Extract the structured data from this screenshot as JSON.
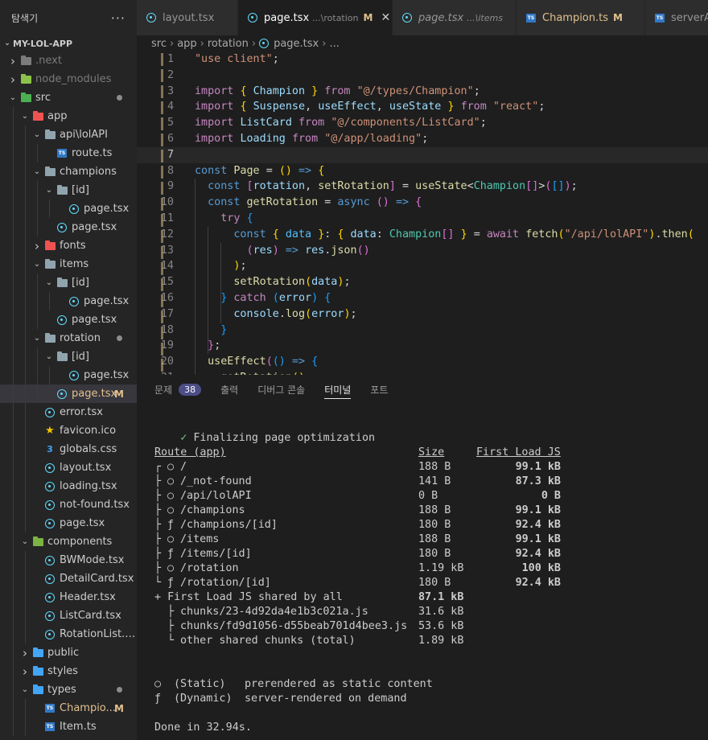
{
  "sidebar": {
    "title": "탐색기",
    "more": "···",
    "root": "MY-LOL-APP",
    "items": [
      {
        "label": ".next",
        "type": "folder-next"
      },
      {
        "label": "node_modules",
        "type": "folder-node"
      },
      {
        "label": "src",
        "type": "folder-src"
      },
      {
        "label": "app",
        "type": "folder-app"
      },
      {
        "label": "api\\lolAPI",
        "type": "folder"
      },
      {
        "label": "route.ts",
        "type": "ts"
      },
      {
        "label": "champions",
        "type": "folder"
      },
      {
        "label": "[id]",
        "type": "folder"
      },
      {
        "label": "page.tsx",
        "type": "react"
      },
      {
        "label": "page.tsx",
        "type": "react"
      },
      {
        "label": "fonts",
        "type": "folder-fonts"
      },
      {
        "label": "items",
        "type": "folder"
      },
      {
        "label": "[id]",
        "type": "folder"
      },
      {
        "label": "page.tsx",
        "type": "react"
      },
      {
        "label": "page.tsx",
        "type": "react"
      },
      {
        "label": "rotation",
        "type": "folder"
      },
      {
        "label": "[id]",
        "type": "folder"
      },
      {
        "label": "page.tsx",
        "type": "react"
      },
      {
        "label": "page.tsx",
        "type": "react",
        "badge": "M"
      },
      {
        "label": "error.tsx",
        "type": "react"
      },
      {
        "label": "favicon.ico",
        "type": "star"
      },
      {
        "label": "globals.css",
        "type": "css"
      },
      {
        "label": "layout.tsx",
        "type": "react"
      },
      {
        "label": "loading.tsx",
        "type": "react"
      },
      {
        "label": "not-found.tsx",
        "type": "react"
      },
      {
        "label": "page.tsx",
        "type": "react"
      },
      {
        "label": "components",
        "type": "folder-comp"
      },
      {
        "label": "BWMode.tsx",
        "type": "react"
      },
      {
        "label": "DetailCard.tsx",
        "type": "react"
      },
      {
        "label": "Header.tsx",
        "type": "react"
      },
      {
        "label": "ListCard.tsx",
        "type": "react"
      },
      {
        "label": "RotationList.tsx",
        "type": "react"
      },
      {
        "label": "public",
        "type": "folder-public"
      },
      {
        "label": "styles",
        "type": "folder-styles"
      },
      {
        "label": "types",
        "type": "folder-types"
      },
      {
        "label": "Champio...",
        "type": "ts",
        "badge": "M"
      },
      {
        "label": "Item.ts",
        "type": "ts"
      }
    ]
  },
  "tabs": [
    {
      "label": "layout.tsx",
      "path": "",
      "flag": ""
    },
    {
      "label": "page.tsx",
      "path": "...\\rotation",
      "flag": "M"
    },
    {
      "label": "page.tsx",
      "path": "...\\items",
      "flag": ""
    },
    {
      "label": "Champion.ts",
      "path": "",
      "flag": "M"
    },
    {
      "label": "serverA",
      "path": "",
      "flag": ""
    }
  ],
  "breadcrumb": [
    "src",
    "app",
    "rotation",
    "page.tsx",
    "..."
  ],
  "editor": {
    "line_numbers": [
      "1",
      "2",
      "3",
      "4",
      "5",
      "6",
      "7",
      "8",
      "9",
      "10",
      "11",
      "12",
      "13",
      "14",
      "15",
      "16",
      "17",
      "18",
      "19",
      "20",
      "21"
    ],
    "current_line": "7"
  },
  "panel": {
    "tabs": [
      "문제",
      "출력",
      "디버그 콘솔",
      "터미널",
      "포트"
    ],
    "problems_count": "38"
  },
  "terminal": {
    "check": "✓",
    "finalizing": "Finalizing page optimization",
    "headers": {
      "route": "Route (app)",
      "size": "Size",
      "first_load": "First Load JS"
    },
    "routes": [
      {
        "tree": "┌",
        "sym": "○",
        "path": "/",
        "size": "188 B",
        "load": "99.1 kB"
      },
      {
        "tree": "├",
        "sym": "○",
        "path": "/_not-found",
        "size": "141 B",
        "load": "87.3 kB"
      },
      {
        "tree": "├",
        "sym": "○",
        "path": "/api/lolAPI",
        "size": "0 B",
        "load": "0 B"
      },
      {
        "tree": "├",
        "sym": "○",
        "path": "/champions",
        "size": "188 B",
        "load": "99.1 kB"
      },
      {
        "tree": "├",
        "sym": "ƒ",
        "path": "/champions/[id]",
        "size": "180 B",
        "load": "92.4 kB"
      },
      {
        "tree": "├",
        "sym": "○",
        "path": "/items",
        "size": "188 B",
        "load": "99.1 kB"
      },
      {
        "tree": "├",
        "sym": "ƒ",
        "path": "/items/[id]",
        "size": "180 B",
        "load": "92.4 kB"
      },
      {
        "tree": "├",
        "sym": "○",
        "path": "/rotation",
        "size": "1.19 kB",
        "load": "100 kB"
      },
      {
        "tree": "└",
        "sym": "ƒ",
        "path": "/rotation/[id]",
        "size": "180 B",
        "load": "92.4 kB"
      }
    ],
    "shared": {
      "label": "+ First Load JS shared by all",
      "value": "87.1 kB"
    },
    "chunks": [
      {
        "tree": "├",
        "name": "chunks/23-4d92da4e1b3c021a.js",
        "size": "31.6 kB"
      },
      {
        "tree": "├",
        "name": "chunks/fd9d1056-d55beab701d4bee3.js",
        "size": "53.6 kB"
      },
      {
        "tree": "└",
        "name": "other shared chunks (total)",
        "size": "1.89 kB"
      }
    ],
    "legend": [
      {
        "sym": "○",
        "kind": "(Static)",
        "desc": "prerendered as static content"
      },
      {
        "sym": "ƒ",
        "kind": "(Dynamic)",
        "desc": "server-rendered on demand"
      }
    ],
    "done": "Done in 32.94s."
  },
  "colors": {
    "editor_bg": "#1e1e1e",
    "sidebar_bg": "#252526",
    "modified": "#e2c08d",
    "badge": "#4d4d87"
  }
}
